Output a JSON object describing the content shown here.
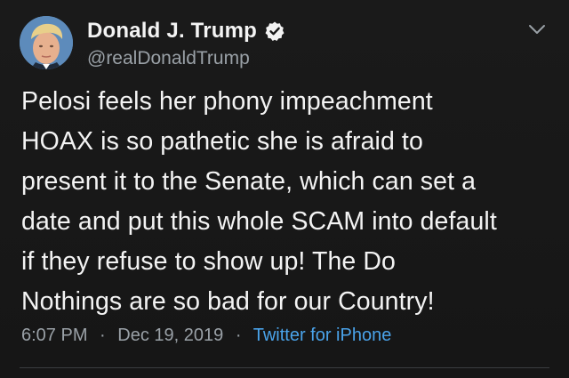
{
  "tweet": {
    "display_name": "Donald J. Trump",
    "handle": "@realDonaldTrump",
    "text": "Pelosi feels her phony impeachment\nHOAX is so pathetic she is afraid to\npresent it to the Senate, which can set a\ndate and put this whole SCAM into default\nif they refuse to show up! The Do\nNothings are so bad for our Country!",
    "time": "6:07 PM",
    "separator": "·",
    "date": "Dec 19, 2019",
    "source": "Twitter for iPhone",
    "icons": {
      "verified": "verified-badge-icon",
      "menu": "chevron-down-icon"
    }
  },
  "colors": {
    "background": "#161616",
    "text": "#f3f3f3",
    "secondary": "#9aa1a7",
    "link": "#4aa3ea",
    "divider": "#3a3d40"
  }
}
